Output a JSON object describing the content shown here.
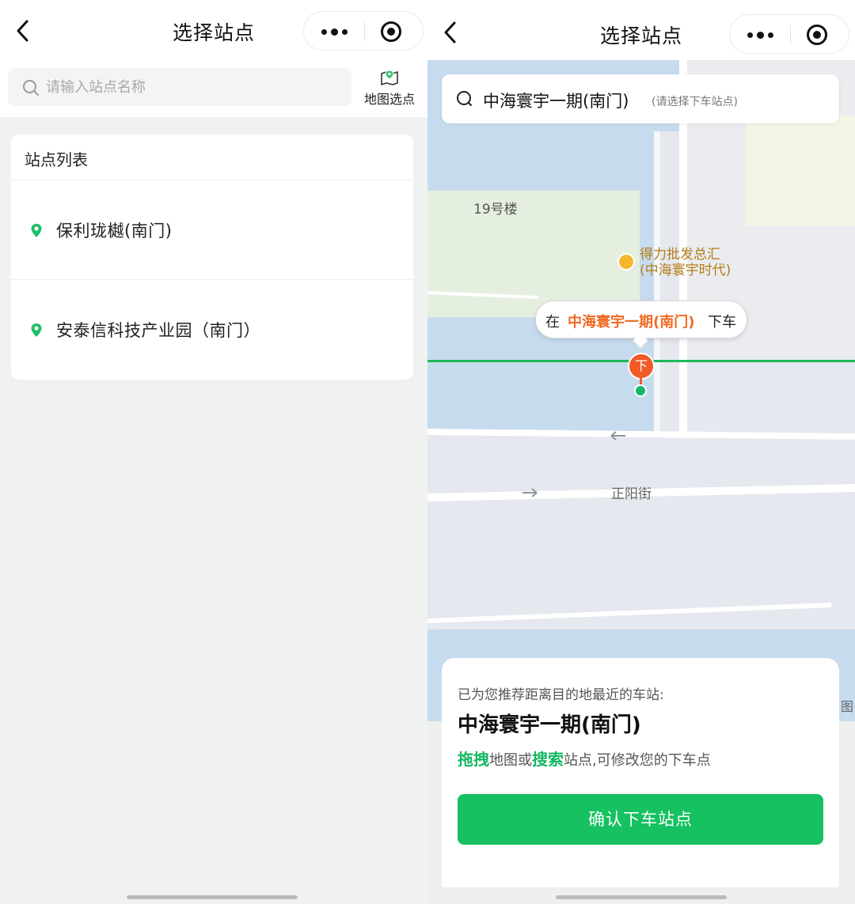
{
  "left": {
    "title": "选择站点",
    "search": {
      "placeholder": "请输入站点名称",
      "value": ""
    },
    "map_pick_label": "地图选点",
    "list_header": "站点列表",
    "stations": [
      "保利珑樾(南门)",
      "安泰信科技产业园（南门）"
    ]
  },
  "right": {
    "title": "选择站点",
    "search_value": "中海寰宇一期(南门)",
    "search_hint": "(请选择下车站点)",
    "map_labels": {
      "building": "19号楼",
      "poi_line1": "得力批发总汇",
      "poi_line2": "(中海寰宇时代)",
      "street": "正阳街",
      "edge_glyph": "图"
    },
    "callout": {
      "prefix": "在",
      "station": "中海寰宇一期(南门)",
      "suffix": "下车"
    },
    "pin_label": "下",
    "card": {
      "recommend_text": "已为您推荐距离目的地最近的车站:",
      "station": "中海寰宇一期(南门)",
      "hint_drag": "拖拽",
      "hint_mid": "地图或",
      "hint_search": "搜索",
      "hint_end": "站点,可修改您的下车点",
      "confirm_label": "确认下车站点"
    }
  },
  "colors": {
    "brand_green": "#15c160",
    "highlight_orange": "#f06a23",
    "pin_red": "#f05a28",
    "route_green": "#1fb85a"
  },
  "icons": [
    "back-arrow-icon",
    "more-dots-icon",
    "target-icon",
    "search-icon",
    "map-pin-icon",
    "location-pin-icon",
    "poi-shop-icon"
  ]
}
